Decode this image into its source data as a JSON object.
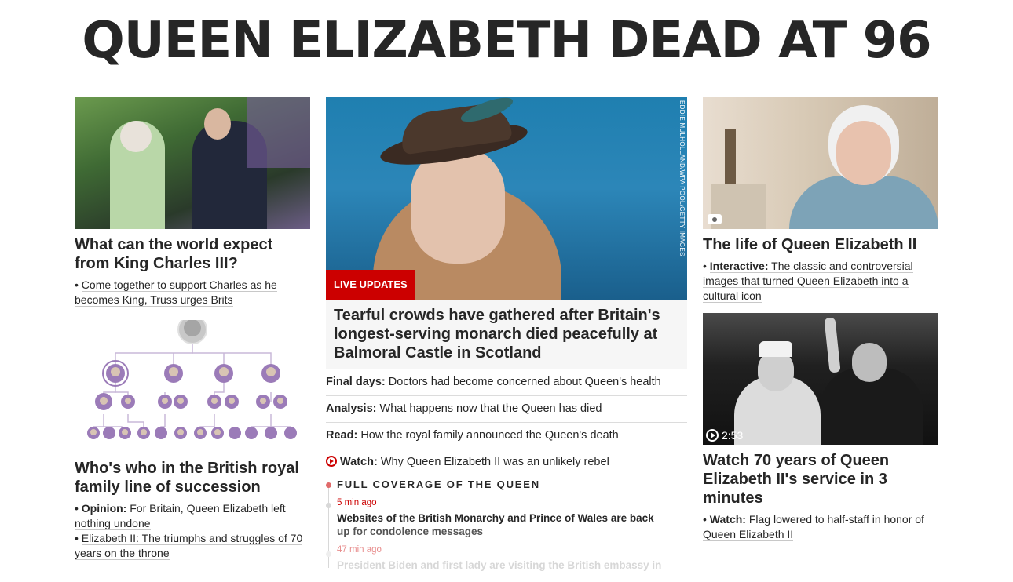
{
  "headline": "QUEEN ELIZABETH DEAD AT 96",
  "left": {
    "card1": {
      "title": "What can the world expect from King Charles III?",
      "sub": "Come together to support Charles as he becomes King, Truss urges Brits"
    },
    "card2": {
      "title": "Who's who in the British royal family line of succession",
      "sub1_label": "Opinion:",
      "sub1_text": "For Britain, Queen Elizabeth left nothing undone",
      "sub2_text": "Elizabeth II: The triumphs and struggles of 70 years on the throne"
    }
  },
  "middle": {
    "badge": "LIVE UPDATES",
    "credit": "EDDIE MULHOLLAND/WPA POOL/GETTY IMAGES",
    "title": "Tearful crowds have gathered after Britain's longest-serving monarch died peacefully at Balmoral Castle in Scotland",
    "rows": [
      {
        "label": "Final days:",
        "text": "Doctors had become concerned about Queen's health"
      },
      {
        "label": "Analysis:",
        "text": "What happens now that the Queen has died"
      },
      {
        "label": "Read:",
        "text": "How the royal family announced the Queen's death"
      },
      {
        "label": "Watch:",
        "text": "Why Queen Elizabeth II was an unlikely rebel"
      }
    ],
    "coverage": {
      "heading": "FULL COVERAGE OF THE QUEEN",
      "items": [
        {
          "time": "5 min ago",
          "text_a": "Websites of the British Monarchy and Prince of Wales are back",
          "text_b": "up for condolence messages"
        },
        {
          "time": "47 min ago",
          "text_a": "President Biden and first lady are visiting the British embassy in"
        }
      ]
    }
  },
  "right": {
    "card1": {
      "title": "The life of Queen Elizabeth II",
      "sub_label": "Interactive:",
      "sub_text": "The classic and controversial images that turned Queen Elizabeth into a cultural icon"
    },
    "card2": {
      "duration": "2:53",
      "title": "Watch 70 years of Queen Elizabeth II's service in 3 minutes",
      "sub_label": "Watch:",
      "sub_text": "Flag lowered to half-staff in honor of Queen Elizabeth II"
    }
  },
  "colors": {
    "accent_red": "#cc0000",
    "text": "#262626",
    "tree_purple": "#9b7bb8"
  }
}
